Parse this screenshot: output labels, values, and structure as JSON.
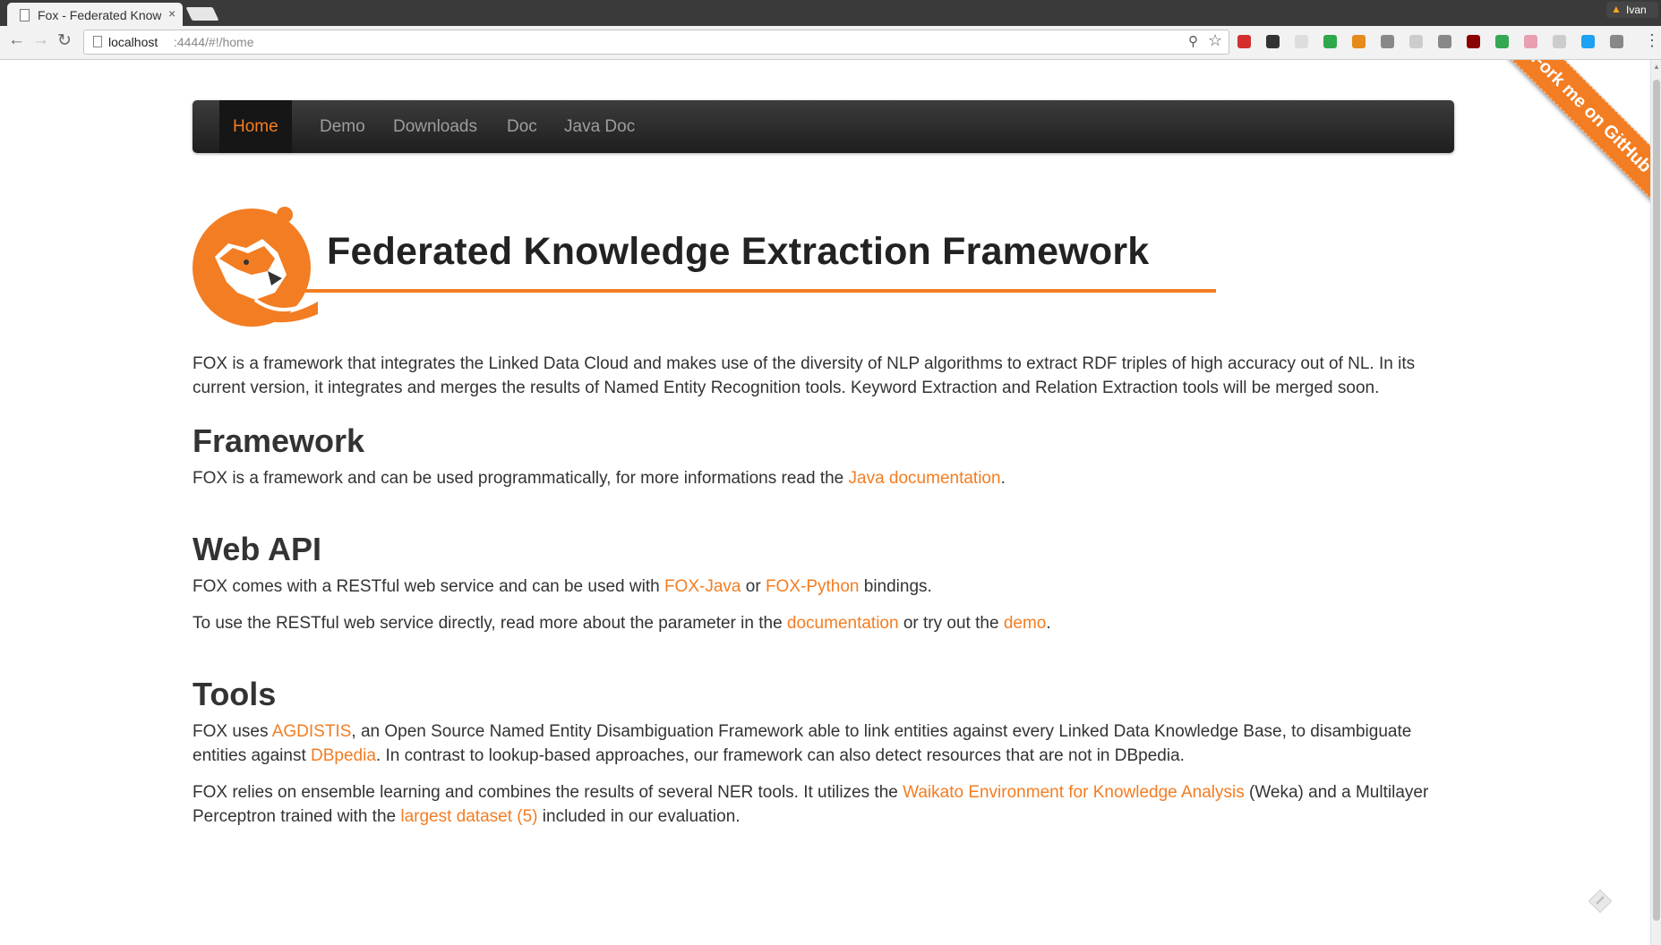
{
  "browser": {
    "tab_title": "Fox - Federated Knowledge Extraction Framework",
    "tab_close": "×",
    "profile_name": "Ivan",
    "url_host": "localhost",
    "url_rest": ":4444/#!/home",
    "back_icon": "←",
    "forward_icon": "→",
    "reload_icon": "↻",
    "zoom_icon": "⚲",
    "star_icon": "☆",
    "menu_icon": "⋮",
    "extension_icons": [
      "lastpass-icon",
      "ghostery-icon",
      "feather-icon",
      "green-circle-icon",
      "toolbox-icon",
      "tiny-icon",
      "grid-icon",
      "g-icon",
      "ublock-icon",
      "sheet-icon",
      "brush-icon",
      "chat-icon",
      "twitter-icon",
      "gear-off-icon"
    ],
    "extension_colors": [
      "#d32f2f",
      "#333333",
      "#dddddd",
      "#2ea84a",
      "#e58a1b",
      "#888888",
      "#cccccc",
      "#888888",
      "#8b0000",
      "#34a853",
      "#e8a0b0",
      "#cccccc",
      "#1da1f2",
      "#888888"
    ]
  },
  "navbar": {
    "items": [
      "Home",
      "Demo",
      "Downloads",
      "Doc",
      "Java Doc"
    ],
    "active": "Home"
  },
  "ribbon": {
    "label": "Fork me on GitHub"
  },
  "hero": {
    "title": "Federated Knowledge Extraction Framework"
  },
  "intro": "FOX is a framework that integrates the Linked Data Cloud and makes use of the diversity of NLP algorithms to extract RDF triples of high accuracy out of NL. In its current version, it integrates and merges the results of Named Entity Recognition tools. Keyword Extraction and Relation Extraction tools will be merged soon.",
  "framework": {
    "heading": "Framework",
    "text_before": "FOX is a framework and can be used programmatically, for more informations read the ",
    "link": "Java documentation",
    "text_after": "."
  },
  "webapi": {
    "heading": "Web API",
    "p1_before": "FOX comes with a RESTful web service and can be used with ",
    "p1_link1": "FOX-Java",
    "p1_mid": " or ",
    "p1_link2": "FOX-Python",
    "p1_after": " bindings.",
    "p2_before": "To use the RESTful web service directly, read more about the parameter in the ",
    "p2_link1": "documentation",
    "p2_mid": " or try out the ",
    "p2_link2": "demo",
    "p2_after": "."
  },
  "tools": {
    "heading": "Tools",
    "p1_before": "FOX uses ",
    "p1_link1": "AGDISTIS",
    "p1_mid": ", an Open Source Named Entity Disambiguation Framework able to link entities against every Linked Data Knowledge Base, to disambiguate entities against ",
    "p1_link2": "DBpedia",
    "p1_after": ". In contrast to lookup-based approaches, our framework can also detect resources that are not in DBpedia.",
    "p2_before": "FOX relies on ensemble learning and combines the results of several NER tools. It utilizes the ",
    "p2_link1": "Waikato Environment for Knowledge Analysis",
    "p2_mid": " (Weka) and a Multilayer Perceptron trained with the ",
    "p2_link2": "largest dataset (5)",
    "p2_after": " included in our evaluation."
  },
  "colors": {
    "accent": "#f37d22",
    "navbar": "#222222",
    "text": "#333333"
  }
}
